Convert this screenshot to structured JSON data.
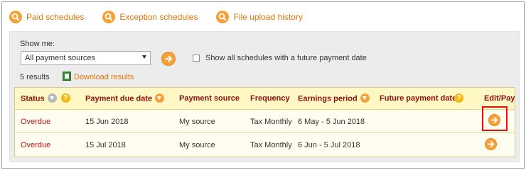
{
  "nav": {
    "links": [
      {
        "label": "Paid schedules",
        "icon": "search-icon"
      },
      {
        "label": "Exception schedules",
        "icon": "search-icon"
      },
      {
        "label": "File upload history",
        "icon": "search-icon"
      }
    ]
  },
  "filter": {
    "show_me_label": "Show me:",
    "source_select_value": "All payment sources",
    "future_checkbox_label": "Show all schedules with a future payment date",
    "future_checkbox_checked": false
  },
  "results": {
    "count_label": "5 results",
    "download_label": "Download results"
  },
  "table": {
    "headers": {
      "status": "Status",
      "due_date": "Payment due date",
      "source": "Payment source",
      "frequency": "Frequency",
      "period": "Earnings period",
      "future_date": "Future payment date",
      "edit": "Edit/Pay"
    },
    "rows": [
      {
        "status": "Overdue",
        "due_date": "15 Jun 2018",
        "source": "My source",
        "frequency": "Tax Monthly",
        "period": "6 May - 5 Jun 2018",
        "future_date": "",
        "highlighted": true
      },
      {
        "status": "Overdue",
        "due_date": "15 Jul 2018",
        "source": "My source",
        "frequency": "Tax Monthly",
        "period": "6 Jun - 5 Jul 2018",
        "future_date": "",
        "highlighted": false
      }
    ]
  },
  "colors": {
    "accent_orange": "#f5a23a",
    "link_orange": "#e0780f",
    "header_text": "#8b1010",
    "status_red": "#cc1010",
    "highlight_red": "#e01010"
  }
}
